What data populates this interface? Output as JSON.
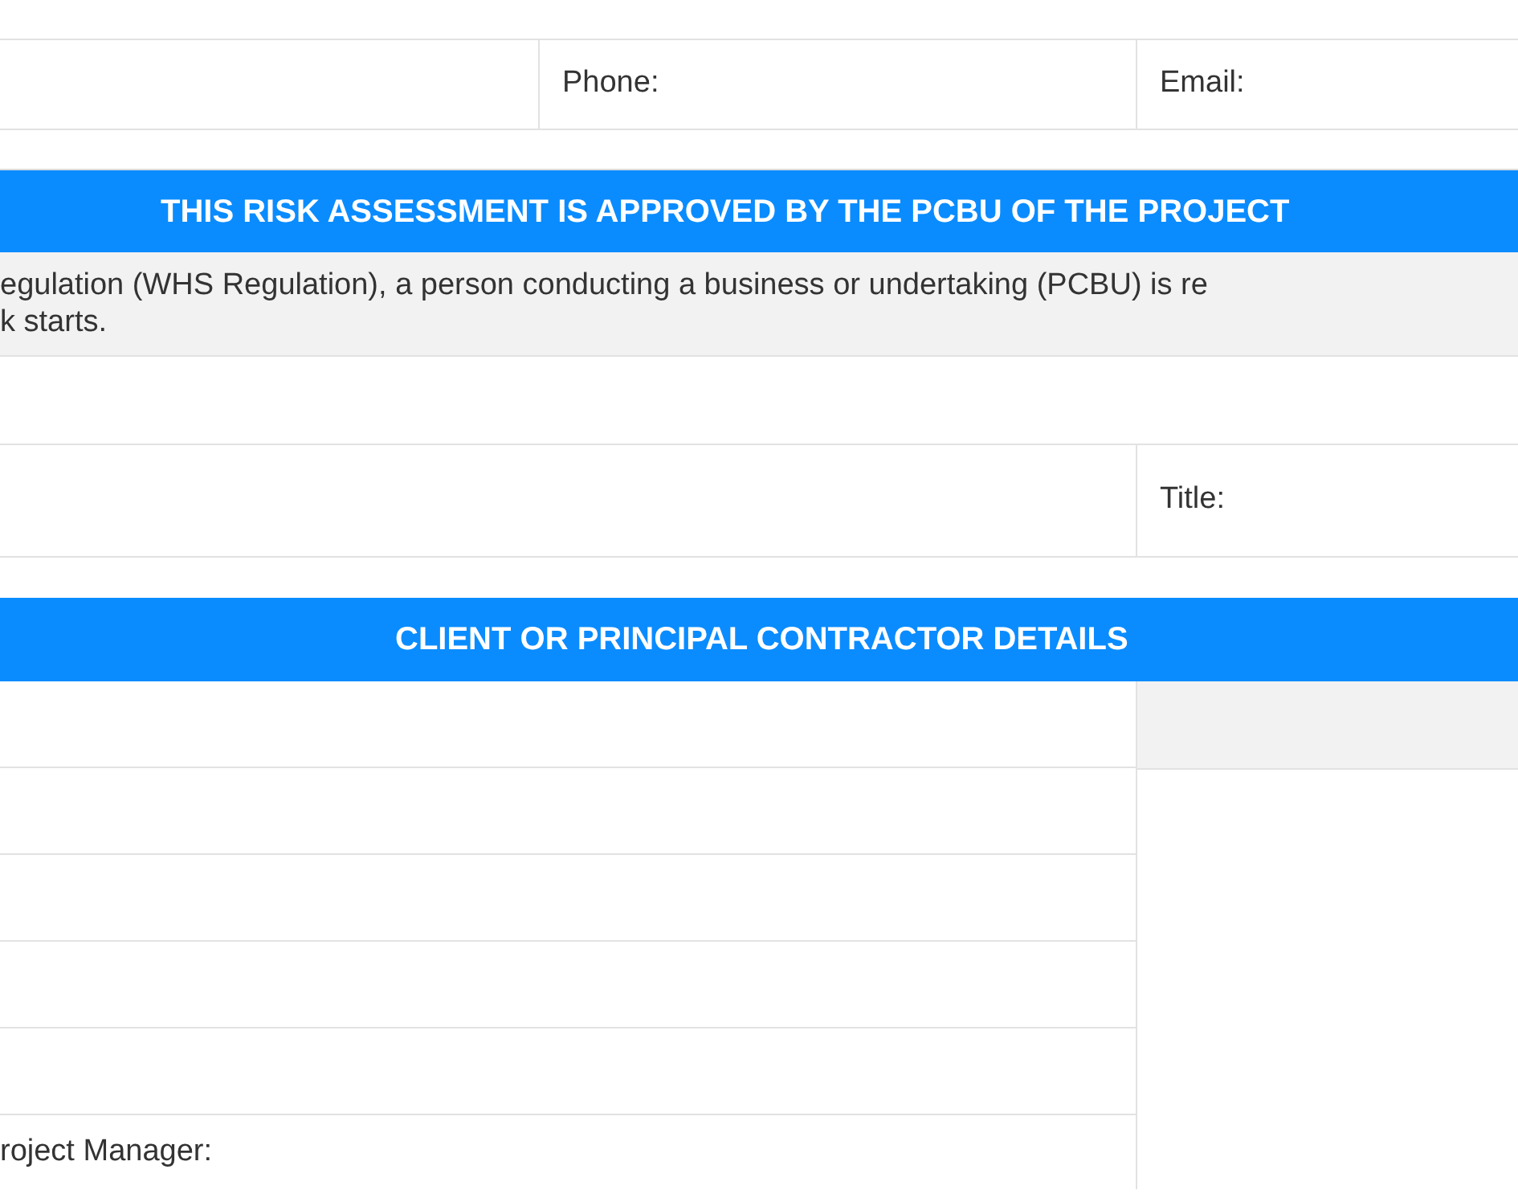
{
  "contact_row": {
    "phone_label": "Phone:",
    "email_label": "Email:"
  },
  "approval_section": {
    "heading": "THIS RISK ASSESSMENT IS APPROVED BY THE PCBU OF THE PROJECT",
    "note_lines": [
      "egulation (WHS Regulation), a person conducting a business or undertaking (PCBU) is re",
      "k starts."
    ],
    "title_label": "Title:"
  },
  "client_section": {
    "heading": "CLIENT OR PRINCIPAL CONTRACTOR DETAILS",
    "last_label": "roject Manager:"
  }
}
